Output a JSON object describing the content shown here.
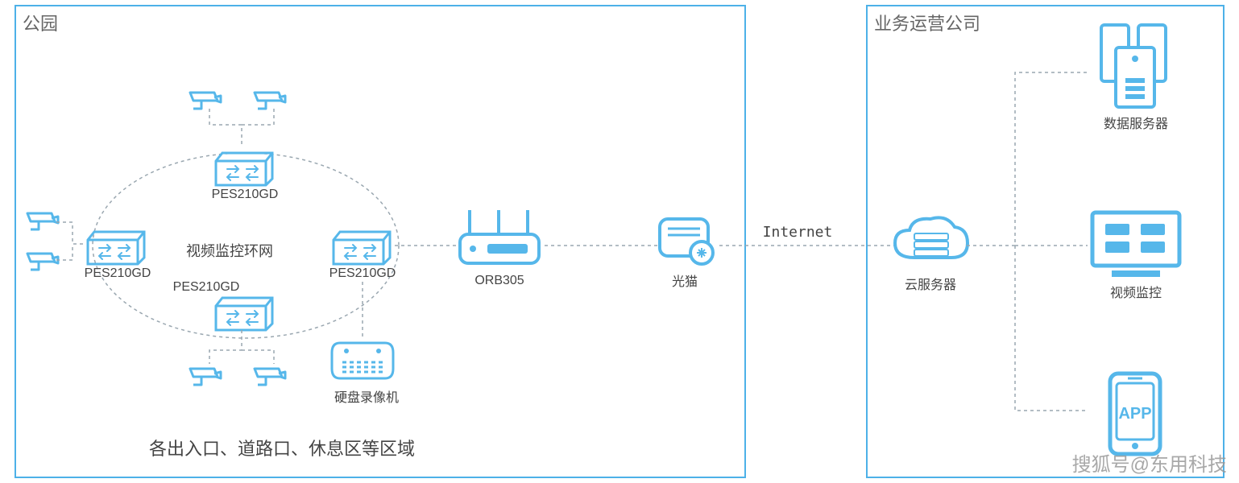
{
  "colors": {
    "accent": "#56b7ea",
    "line": "#b9c4cc",
    "text": "#555"
  },
  "left_box": {
    "title": "公园",
    "bottom_caption": "各出入口、道路口、休息区等区域",
    "ring_label": "视频监控环网",
    "switches": {
      "top": "PES210GD",
      "left": "PES210GD",
      "right": "PES210GD",
      "bottom": "PES210GD"
    },
    "nvr_label": "硬盘录像机",
    "router_label": "ORB305",
    "modem_label": "光猫"
  },
  "link_label": "Internet",
  "right_box": {
    "title": "业务运营公司",
    "cloud_label": "云服务器",
    "servers_label": "数据服务器",
    "monitor_label": "视频监控",
    "app_label": "APP"
  },
  "watermark": "搜狐号@东用科技"
}
